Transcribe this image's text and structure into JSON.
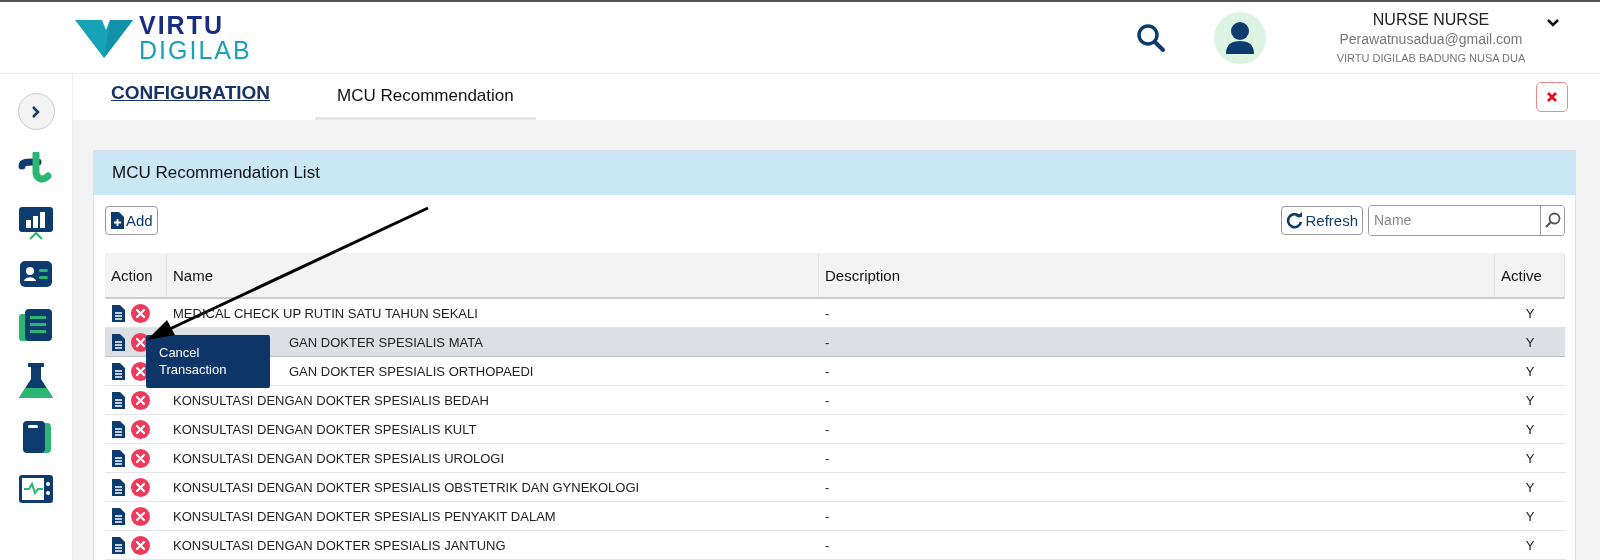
{
  "header": {
    "logo": {
      "line1": "VIRTU",
      "line2": "DIGILAB"
    },
    "user": {
      "name": "NURSE NURSE",
      "email": "Perawatnusadua@gmail.com",
      "branch": "VIRTU DIGILAB BADUNG NUSA DUA"
    }
  },
  "breadcrumb": {
    "section": "CONFIGURATION",
    "tabs": [
      {
        "label": "MCU Recommendation",
        "selected": true
      }
    ]
  },
  "panel": {
    "title": "MCU Recommendation List",
    "add_button": "Add",
    "refresh_button": "Refresh",
    "search": {
      "placeholder": "Name"
    },
    "table": {
      "columns": [
        "Action",
        "Name",
        "Description",
        "Active"
      ],
      "rows": [
        {
          "name": "MEDICAL CHECK UP RUTIN SATU TAHUN SEKALI",
          "description": "-",
          "active": "Y",
          "hovered": false,
          "covered": false
        },
        {
          "name": "GAN DOKTER SPESIALIS MATA",
          "description": "-",
          "active": "Y",
          "hovered": true,
          "covered": true,
          "tooltip": "Cancel Transaction"
        },
        {
          "name": "GAN DOKTER SPESIALIS ORTHOPAEDI",
          "description": "-",
          "active": "Y",
          "hovered": false,
          "covered": true
        },
        {
          "name": "KONSULTASI DENGAN DOKTER SPESIALIS BEDAH",
          "description": "-",
          "active": "Y",
          "hovered": false,
          "covered": false
        },
        {
          "name": "KONSULTASI DENGAN DOKTER SPESIALIS KULT",
          "description": "-",
          "active": "Y",
          "hovered": false,
          "covered": false
        },
        {
          "name": "KONSULTASI DENGAN DOKTER SPESIALIS UROLOGI",
          "description": "-",
          "active": "Y",
          "hovered": false,
          "covered": false
        },
        {
          "name": "KONSULTASI DENGAN DOKTER SPESIALIS OBSTETRIK DAN GYNEKOLOGI",
          "description": "-",
          "active": "Y",
          "hovered": false,
          "covered": false
        },
        {
          "name": "KONSULTASI DENGAN DOKTER SPESIALIS PENYAKIT DALAM",
          "description": "-",
          "active": "Y",
          "hovered": false,
          "covered": false
        },
        {
          "name": "KONSULTASI DENGAN DOKTER SPESIALIS JANTUNG",
          "description": "-",
          "active": "Y",
          "hovered": false,
          "covered": false
        }
      ]
    }
  }
}
